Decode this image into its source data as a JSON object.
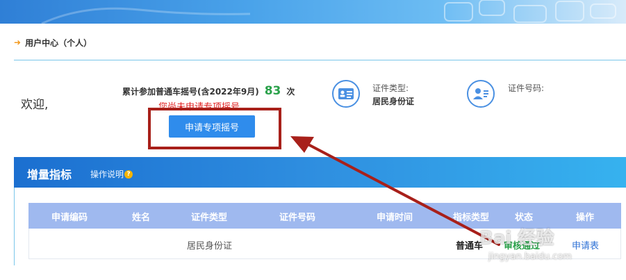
{
  "header": {
    "title": "用户中心（个人）"
  },
  "welcome": {
    "greeting": "欢迎,"
  },
  "participation": {
    "label": "累计参加普通车摇号(含2022年9月)",
    "count": "83",
    "unit": "次"
  },
  "notice": "您尚未申请专项摇号",
  "apply_button_label": "申请专项摇号",
  "id_type": {
    "label": "证件类型:",
    "value": "居民身份证",
    "icon": "id-card-icon"
  },
  "id_number": {
    "label": "证件号码:",
    "icon": "user-card-icon"
  },
  "section": {
    "title": "增量指标",
    "help_label": "操作说明",
    "help_icon": "?"
  },
  "table": {
    "headers": [
      "申请编码",
      "姓名",
      "证件类型",
      "证件号码",
      "申请时间",
      "指标类型",
      "状态",
      "操作"
    ],
    "rows": [
      {
        "id_type": "居民身份证",
        "quota_type": "普通车",
        "status": "审核通过",
        "action": "申请表"
      }
    ]
  },
  "watermark": {
    "logo": "Bai 经验",
    "url": "jingyan.baidu.com"
  },
  "colors": {
    "accent_blue": "#2f8cec",
    "section_bar": "#2f8fe0",
    "table_header": "#9fb9ef",
    "notice_red": "#e02020",
    "count_green": "#2aa14a",
    "annotation_red": "#a8201a"
  }
}
